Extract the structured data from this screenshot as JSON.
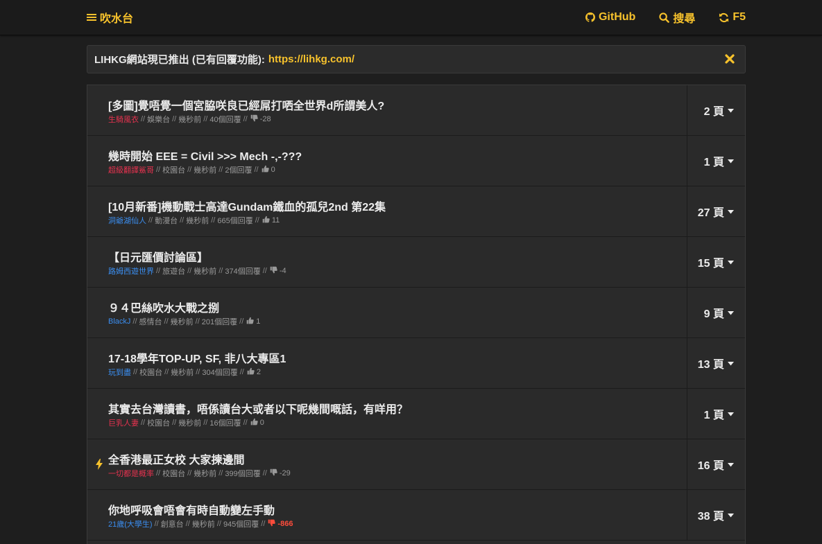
{
  "colors": {
    "accent": "#f7c22c",
    "male": "#3b8ef0",
    "female": "#e5324f",
    "negative": "#ff4c3b"
  },
  "nav": {
    "brand": "吹水台",
    "github": "GitHub",
    "search": "搜尋",
    "refresh": "F5"
  },
  "notice": {
    "text": "LIHKG網站現已推出 (已有回覆功能):",
    "link": "https://lihkg.com/"
  },
  "threads": [
    {
      "title": "[多圖]覺唔覺一個宮脇咲良已經屌打哂全世界d所謂美人?",
      "author": "生騎風衣",
      "gender": "female",
      "category": "娛樂台",
      "time": "幾秒前",
      "replies": "40個回覆",
      "vote": "down",
      "score": "-28",
      "pages": "2 頁",
      "hot": false,
      "scoreStyle": ""
    },
    {
      "title": "幾時開始 EEE = Civil >>> Mech -,-???",
      "author": "超級翻譯鯊哥",
      "gender": "female",
      "category": "校園台",
      "time": "幾秒前",
      "replies": "2個回覆",
      "vote": "up",
      "score": "0",
      "pages": "1 頁",
      "hot": false,
      "scoreStyle": ""
    },
    {
      "title": "[10月新番]機動戰士高達Gundam鐵血的孤兒2nd 第22集",
      "author": "洞爺湖仙人",
      "gender": "male",
      "category": "動漫台",
      "time": "幾秒前",
      "replies": "665個回覆",
      "vote": "up",
      "score": "11",
      "pages": "27 頁",
      "hot": false,
      "scoreStyle": ""
    },
    {
      "title": "【日元匯價討論區】",
      "author": "路姆西遊世界",
      "gender": "male",
      "category": "旅遊台",
      "time": "幾秒前",
      "replies": "374個回覆",
      "vote": "down",
      "score": "-4",
      "pages": "15 頁",
      "hot": false,
      "scoreStyle": ""
    },
    {
      "title": "９４巴絲吹水大戰之捌",
      "author": "BlackJ",
      "gender": "male",
      "category": "感情台",
      "time": "幾秒前",
      "replies": "201個回覆",
      "vote": "up",
      "score": "1",
      "pages": "9 頁",
      "hot": false,
      "scoreStyle": ""
    },
    {
      "title": "17-18學年TOP-UP, SF, 非八大專區1",
      "author": "玩到盡",
      "gender": "male",
      "category": "校園台",
      "time": "幾秒前",
      "replies": "304個回覆",
      "vote": "up",
      "score": "2",
      "pages": "13 頁",
      "hot": false,
      "scoreStyle": ""
    },
    {
      "title": "其實去台灣讀書，唔係讀台大或者以下呢幾間嘅話，有咩用？",
      "author": "巨乳人妻",
      "gender": "female",
      "category": "校園台",
      "time": "幾秒前",
      "replies": "16個回覆",
      "vote": "up",
      "score": "0",
      "pages": "1 頁",
      "hot": false,
      "scoreStyle": ""
    },
    {
      "title": "全香港最正女校 大家揀邊間",
      "author": "一切都是概率",
      "gender": "female",
      "category": "校園台",
      "time": "幾秒前",
      "replies": "399個回覆",
      "vote": "down",
      "score": "-29",
      "pages": "16 頁",
      "hot": true,
      "scoreStyle": ""
    },
    {
      "title": "你地呼吸會唔會有時自動變左手動",
      "author": "21歲(大學生)",
      "gender": "male",
      "category": "創意台",
      "time": "幾秒前",
      "replies": "945個回覆",
      "vote": "down-big",
      "score": "-866",
      "pages": "38 頁",
      "hot": false,
      "scoreStyle": "neg-big"
    }
  ]
}
